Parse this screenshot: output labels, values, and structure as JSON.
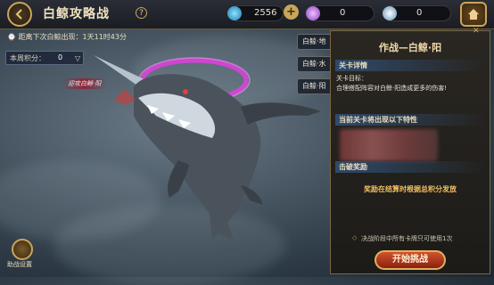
{
  "header": {
    "title": "白鲸攻略战",
    "help": "?",
    "resources": [
      {
        "icon": "blue-gem-icon",
        "value": "2556",
        "color": "#3bb4e6"
      },
      {
        "icon": "purple-orb-icon",
        "value": "0",
        "color": "#b77be0"
      },
      {
        "icon": "crystal-icon",
        "value": "0",
        "color": "#9fc8e8"
      }
    ],
    "plus": "+"
  },
  "timer": "距离下次白鲸出现：1天11时43分",
  "score": {
    "label": "本周积分：",
    "value": "0",
    "arrow": "▽"
  },
  "boss_ribbon": "迎攻白鲸·阳",
  "side_tabs": [
    "白鲸·地",
    "白鲸·水",
    "白鲸·阳"
  ],
  "panel": {
    "title": "作战—白鲸·阳",
    "stage_header": "关卡详情",
    "goal_label": "关卡目标：",
    "goal_text": "合理搭配阵容对白鲸·阳造成更多的伤害!",
    "traits_header": "当前关卡将出现以下特性",
    "reward_header": "击破奖励",
    "reward_text": "奖励在结算时根据总积分发放",
    "note": "决战阶段中所有卡牌只可使用1次",
    "start_button": "开始挑战"
  },
  "assist": "助战设置"
}
